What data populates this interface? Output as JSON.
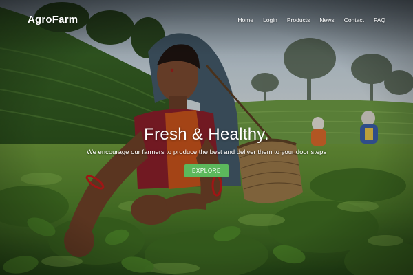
{
  "navbar": {
    "brand": "AgroFarm",
    "links": [
      "Home",
      "Login",
      "Products",
      "News",
      "Contact",
      "FAQ"
    ]
  },
  "hero": {
    "title": "Fresh & Healthy.",
    "subtitle": "We encourage our farmers to produce the best and deliver them to your door steps",
    "cta_label": "EXPLORE",
    "background_image": "tea-plantation-picker-photo"
  },
  "colors": {
    "cta_green": "#5cb85c",
    "text": "#ffffff",
    "foliage_dark": "#2f5a1e",
    "foliage_light": "#7fae4a",
    "sky": "#c9d6df"
  }
}
